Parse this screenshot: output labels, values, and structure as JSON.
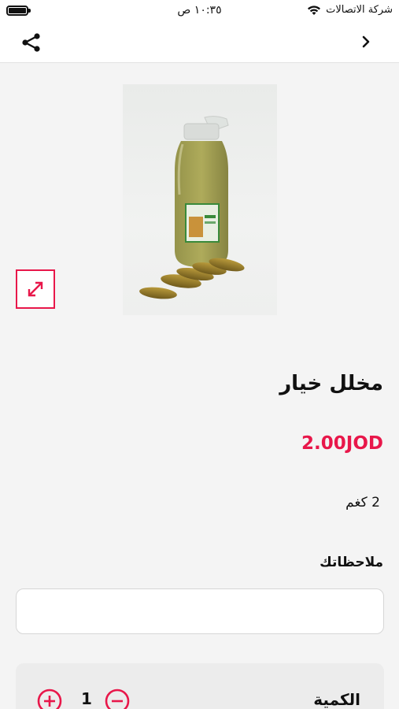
{
  "status_bar": {
    "time": "١٠:٣٥ ص",
    "carrier": "شركة الاتصالات",
    "battery_level": 0.9
  },
  "nav": {
    "share_icon": "share-icon",
    "back_icon": "chevron-right-icon"
  },
  "product": {
    "title": "مخلل خيار",
    "price": "2.00JOD",
    "weight": "2 كغم",
    "image_icon": "pickle-jar-image"
  },
  "notes": {
    "label": "ملاحظاتك",
    "value": "",
    "placeholder": ""
  },
  "quantity": {
    "label": "الكمية",
    "value": "1"
  },
  "colors": {
    "accent": "#e8174a",
    "background": "#f4f4f4"
  }
}
